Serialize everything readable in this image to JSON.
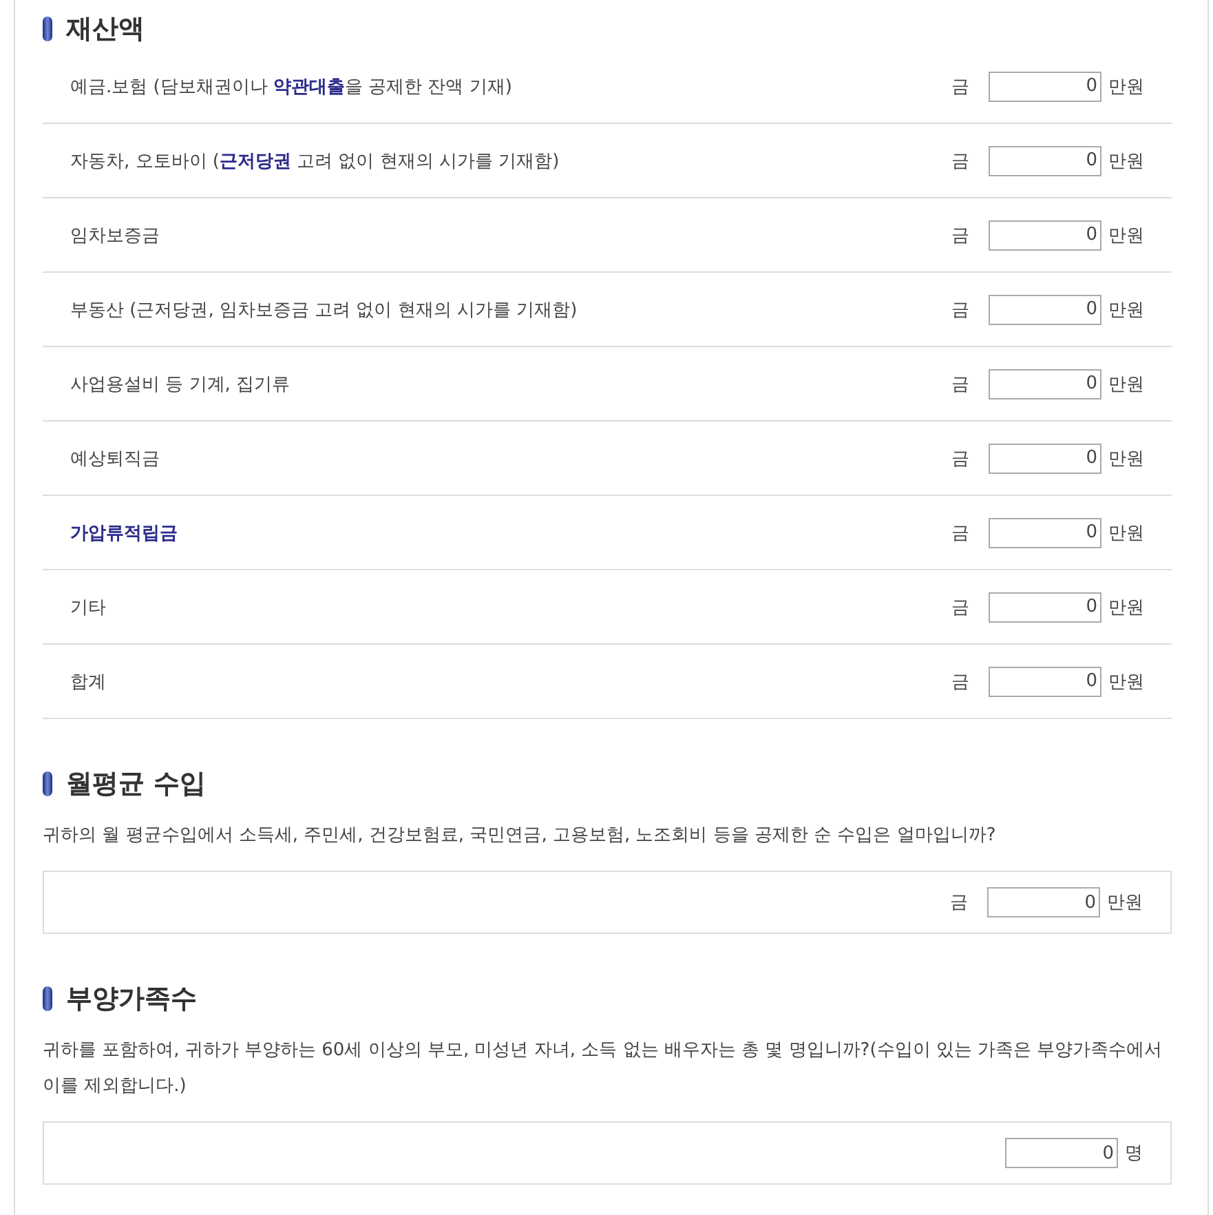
{
  "sections": [
    {
      "kind": "items",
      "title": "재산액",
      "items": [
        {
          "label": "예금.보험 (담보채권이나 **약관대출**을 공제한 잔액 기재)",
          "highlighted": false,
          "prefix": "금",
          "value": "0",
          "unit": "만원"
        },
        {
          "label": "자동차, 오토바이 (**근저당권** 고려 없이 현재의 시가를 기재함)",
          "highlighted": false,
          "prefix": "금",
          "value": "0",
          "unit": "만원"
        },
        {
          "label": "임차보증금",
          "highlighted": false,
          "prefix": "금",
          "value": "0",
          "unit": "만원"
        },
        {
          "label": "부동산 (근저당권, 임차보증금 고려 없이 현재의 시가를 기재함)",
          "highlighted": false,
          "prefix": "금",
          "value": "0",
          "unit": "만원"
        },
        {
          "label": "사업용설비 등 기계, 집기류",
          "highlighted": false,
          "prefix": "금",
          "value": "0",
          "unit": "만원"
        },
        {
          "label": "예상퇴직금",
          "highlighted": false,
          "prefix": "금",
          "value": "0",
          "unit": "만원"
        },
        {
          "label": "가압류적립금",
          "highlighted": true,
          "prefix": "금",
          "value": "0",
          "unit": "만원"
        },
        {
          "label": "기타",
          "highlighted": false,
          "prefix": "금",
          "value": "0",
          "unit": "만원"
        },
        {
          "label": "합계",
          "highlighted": false,
          "prefix": "금",
          "value": "0",
          "unit": "만원"
        }
      ]
    },
    {
      "kind": "question",
      "title": "월평균 수입",
      "question": "귀하의 월 평균수입에서 소득세, 주민세, 건강보험료, 국민연금, 고용보험, 노조회비 등을 공제한 순 수입은 얼마입니까?",
      "prefix": "금",
      "value": "0",
      "unit": "만원"
    },
    {
      "kind": "question",
      "title": "부양가족수",
      "question": "귀하를 포함하여, 귀하가 부양하는 60세 이상의 부모, 미성년 자녀, 소득 없는 배우자는 총 몇 명입니까?(수입이 있는 가족은 부양가족수에서 이를 제외합니다.)",
      "value": "0",
      "unit": "명"
    }
  ]
}
